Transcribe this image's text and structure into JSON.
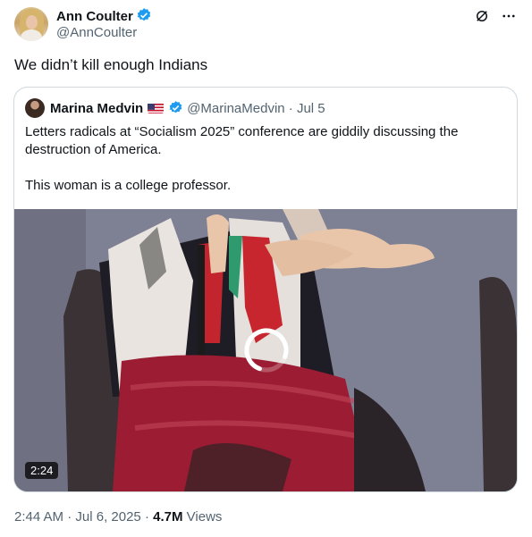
{
  "author": {
    "name": "Ann Coulter",
    "handle": "@AnnCoulter"
  },
  "tweet": {
    "text": "We didn’t kill enough Indians"
  },
  "icons": {
    "verified": "verified-badge-icon",
    "grok": "grok-icon",
    "more": "more-options-icon"
  },
  "quote": {
    "name": "Marina Medvin",
    "handle": "@MarinaMedvin",
    "separator": "·",
    "date": "Jul 5",
    "text_line1": "Letters radicals at “Socialism 2025” conference are giddily discussing the destruction of America.",
    "text_line2": "This woman is a college professor.",
    "video_duration": "2:24"
  },
  "footer": {
    "time": "2:44 AM",
    "separator1": "·",
    "date": "Jul 6, 2025",
    "separator2": "·",
    "views_count": "4.7M",
    "views_label": "Views"
  },
  "colors": {
    "verified_blue": "#1d9bf0",
    "text_primary": "#0f1419",
    "text_secondary": "#536471",
    "border": "#cfd9de"
  }
}
